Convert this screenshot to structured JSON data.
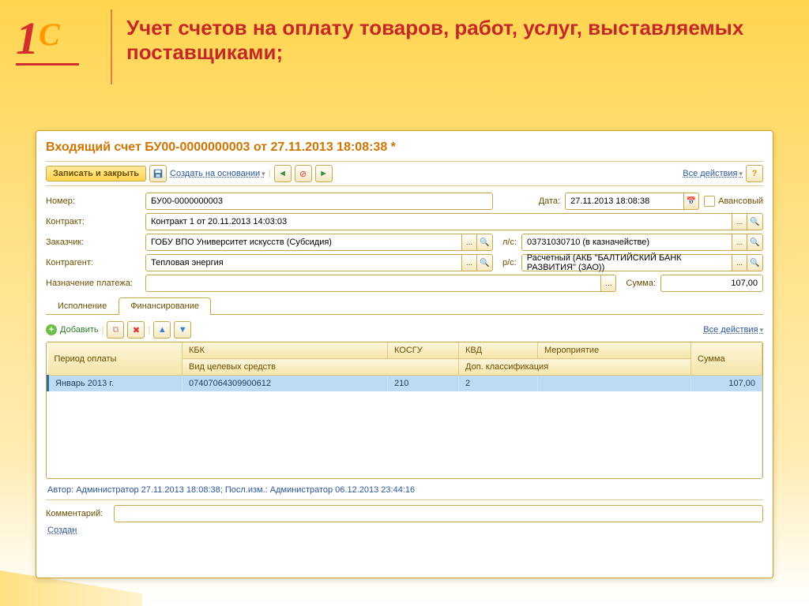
{
  "slide": {
    "title": "Учет счетов на оплату товаров, работ, услуг, выставляемых поставщиками;"
  },
  "window": {
    "title": "Входящий счет БУ00-0000000003 от 27.11.2013 18:08:38 *",
    "all_actions": "Все действия",
    "help": "?"
  },
  "toolbar": {
    "save_close": "Записать и закрыть",
    "create_based": "Создать на основании"
  },
  "form": {
    "number_label": "Номер:",
    "number_value": "БУ00-0000000003",
    "date_label": "Дата:",
    "date_value": "27.11.2013 18:08:38",
    "advance_label": "Авансовый",
    "contract_label": "Контракт:",
    "contract_value": "Контракт 1 от 20.11.2013 14:03:03",
    "customer_label": "Заказчик:",
    "customer_value": "ГОБУ ВПО Университет искусств (Субсидия)",
    "ls_label": "л/с:",
    "ls_value": "03731030710 (в казначействе)",
    "counterparty_label": "Контрагент:",
    "counterparty_value": "Тепловая энергия",
    "rs_label": "р/с:",
    "rs_value": "Расчетный (АКБ \"БАЛТИЙСКИЙ БАНК РАЗВИТИЯ\" (ЗАО))",
    "purpose_label": "Назначение платежа:",
    "purpose_value": "",
    "sum_label": "Сумма:",
    "sum_value": "107,00"
  },
  "tabs": {
    "execution": "Исполнение",
    "financing": "Финансирование"
  },
  "subtoolbar": {
    "add": "Добавить",
    "all_actions": "Все действия"
  },
  "table": {
    "headers": {
      "period": "Период оплаты",
      "kbk": "КБК",
      "kosgu": "КОСГУ",
      "kvd": "КВД",
      "event": "Мероприятие",
      "sum": "Сумма",
      "target_funds": "Вид целевых средств",
      "add_class": "Доп. классификация"
    },
    "rows": [
      {
        "period": "Январь 2013 г.",
        "kbk": "07407064309900612",
        "kosgu": "210",
        "kvd": "2",
        "event": "",
        "sum": "107,00"
      }
    ]
  },
  "status": "Автор: Администратор 27.11.2013 18:08:38; Посл.изм.: Администратор 06.12.2013 23:44:16",
  "comment": {
    "label": "Комментарий:",
    "value": ""
  },
  "create_link": "Создан"
}
